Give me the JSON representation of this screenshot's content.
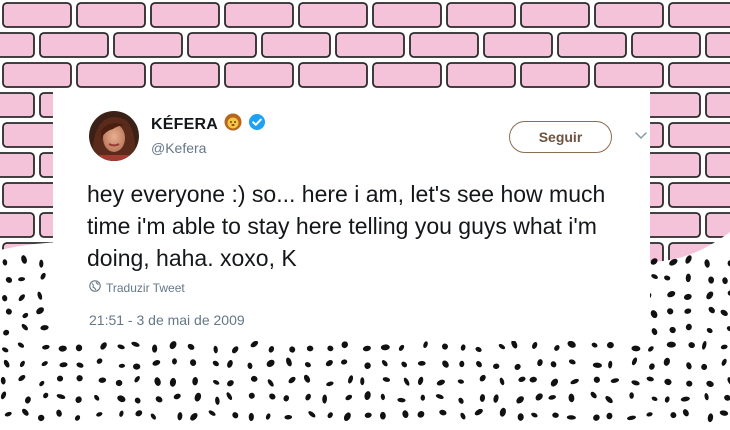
{
  "tweet": {
    "display_name": "KÉFERA",
    "name_emoji": "lion-face-emoji",
    "verified_icon": "verified-badge-icon",
    "handle": "@Kefera",
    "follow_label": "Seguir",
    "more_icon": "chevron-down-icon",
    "text": "hey everyone :) so... here i am, let's see how much time i'm able to stay here telling you guys what i'm doing, haha. xoxo, K",
    "translate_label": "Traduzir Tweet",
    "timestamp": "21:51 - 3 de mai de 2009"
  },
  "colors": {
    "brick_pink": "#f5c3d9",
    "brick_outline": "#2a2a2a",
    "dots": "#111111",
    "verified_blue": "#1da1f2",
    "follow_border": "#8a6d52",
    "muted_text": "#657786",
    "text": "#14171a"
  }
}
